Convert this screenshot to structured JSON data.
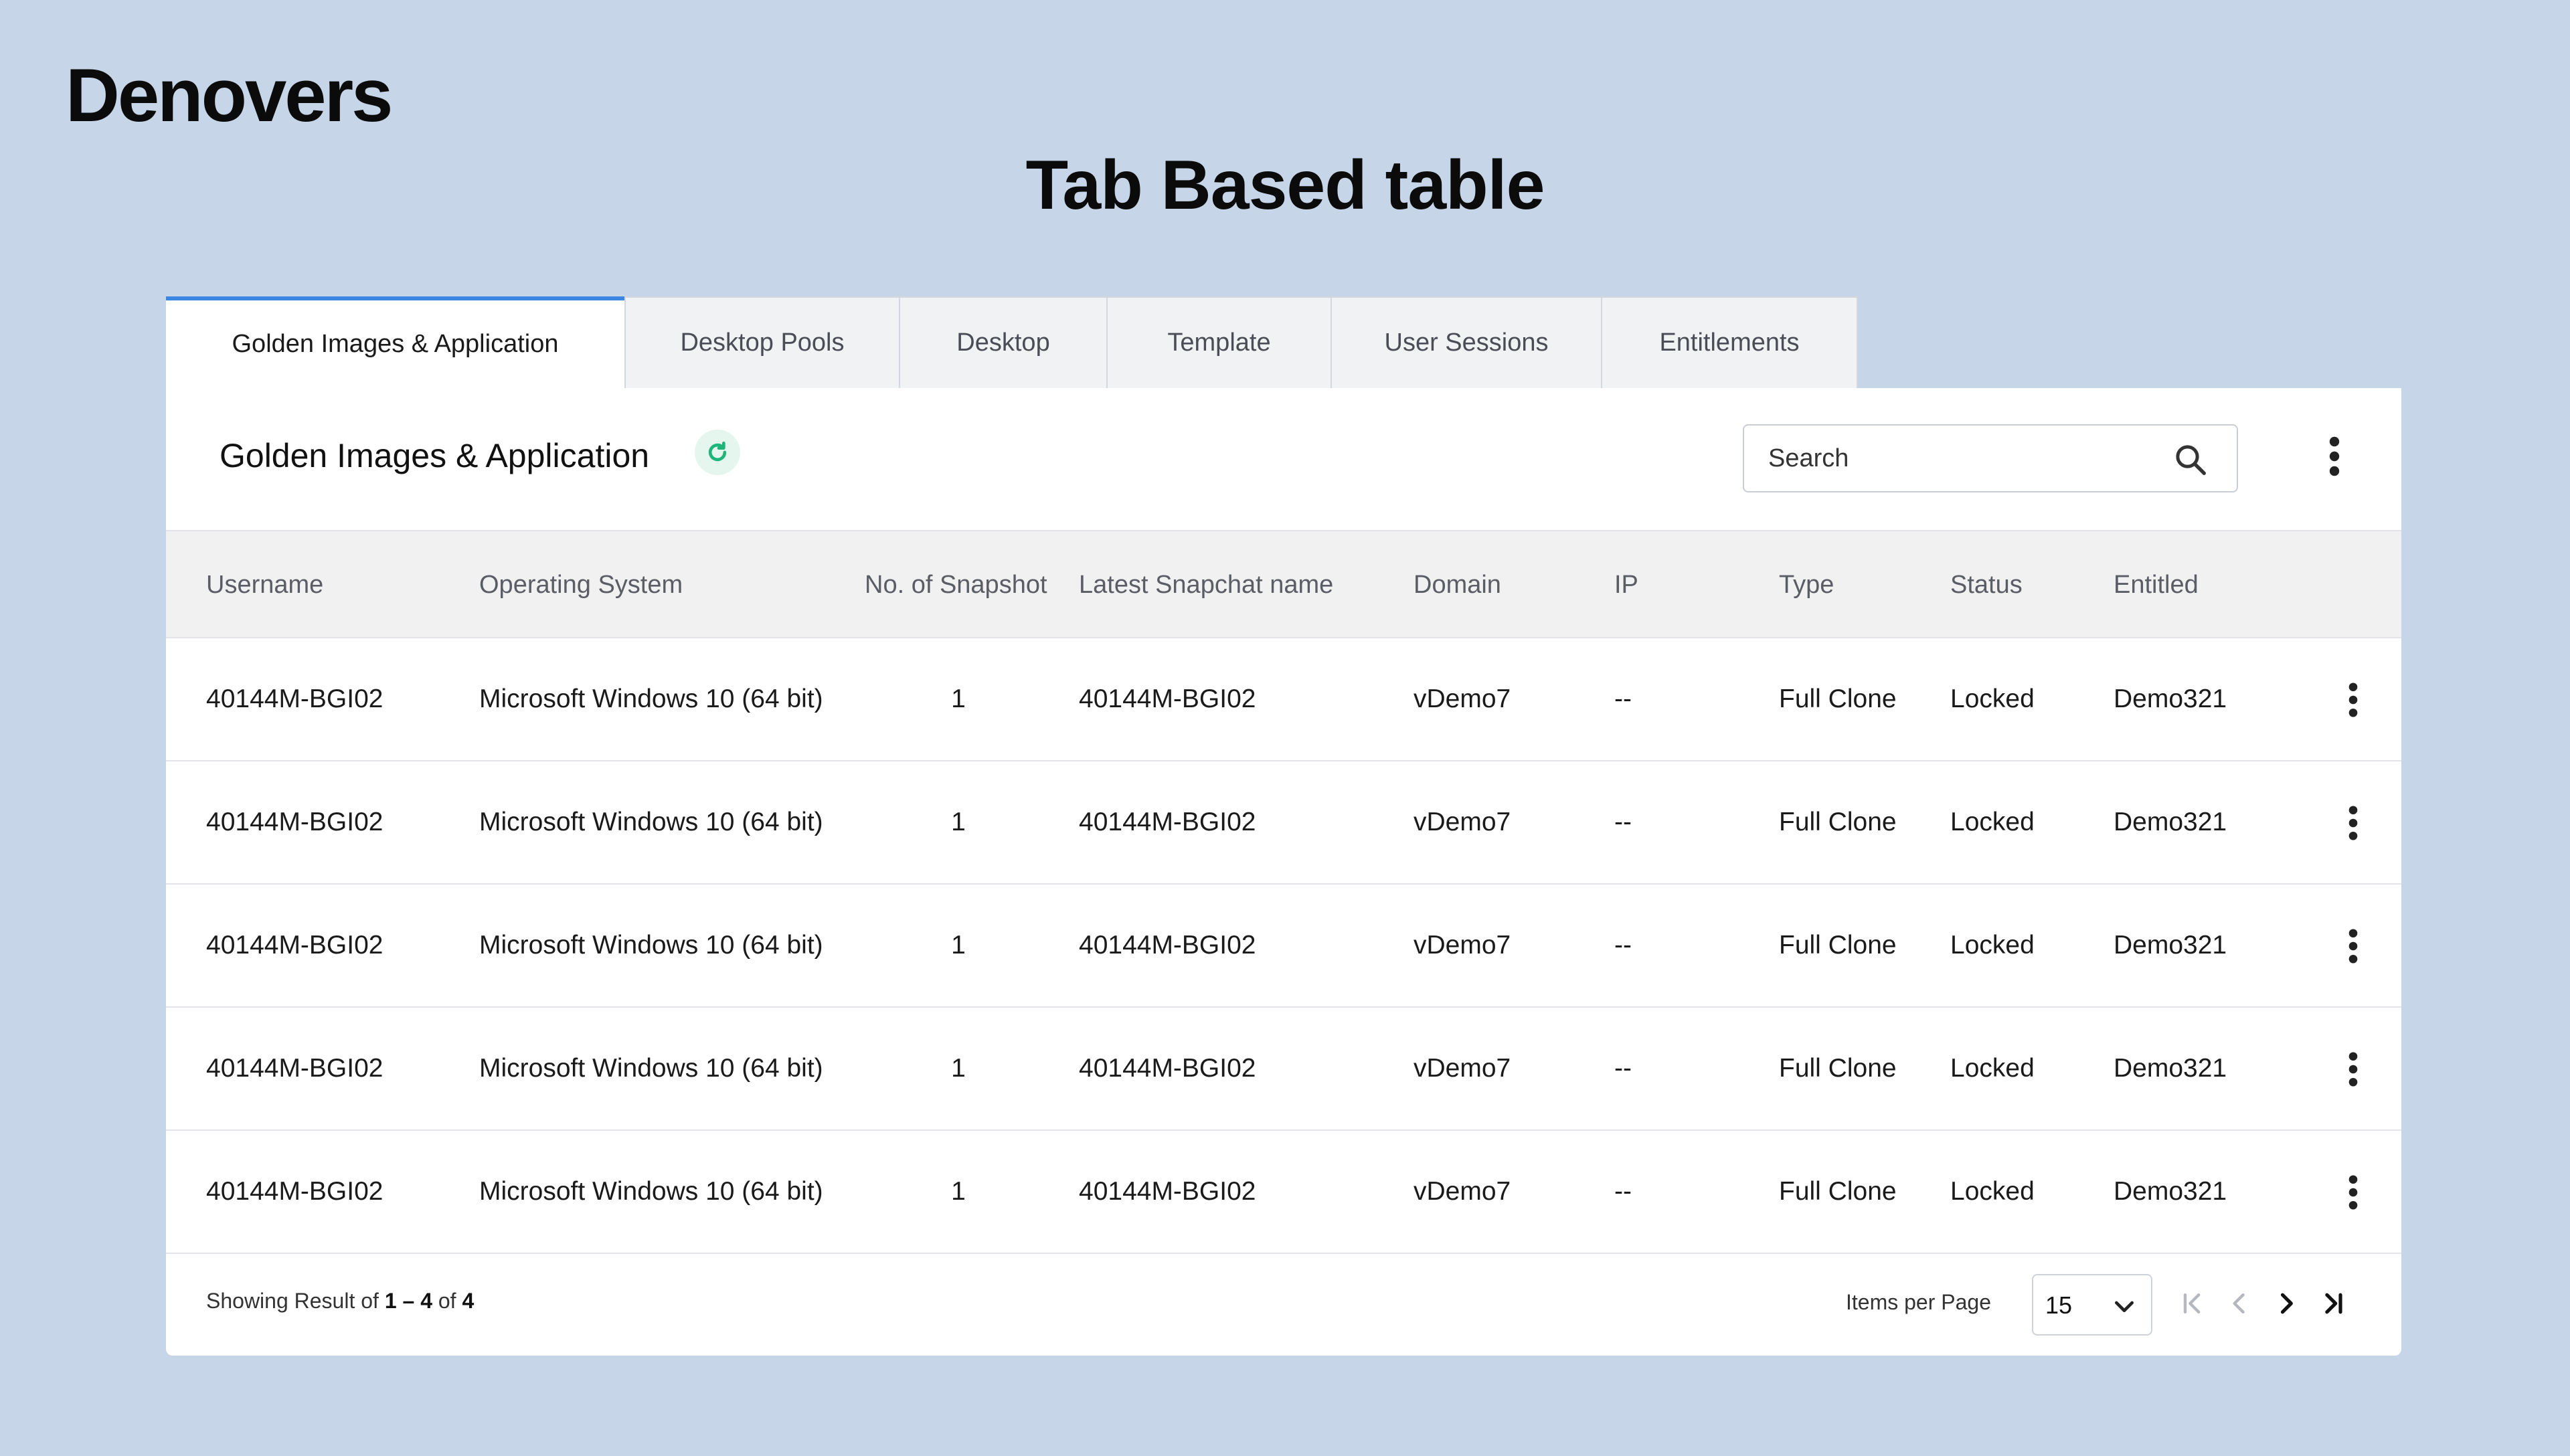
{
  "brand": "Denovers",
  "page_title": "Tab Based table",
  "tabs": [
    {
      "label": "Golden Images & Application",
      "active": true
    },
    {
      "label": "Desktop Pools",
      "active": false
    },
    {
      "label": "Desktop",
      "active": false
    },
    {
      "label": "Template",
      "active": false
    },
    {
      "label": "User Sessions",
      "active": false
    },
    {
      "label": "Entitlements",
      "active": false
    }
  ],
  "card": {
    "title": "Golden Images & Application",
    "refresh_icon": "refresh-icon",
    "search": {
      "placeholder": "Search",
      "value": ""
    },
    "more_icon": "kebab-icon"
  },
  "table": {
    "columns": [
      "Username",
      "Operating System",
      "No. of Snapshot",
      "Latest Snapchat name",
      "Domain",
      "IP",
      "Type",
      "Status",
      "Entitled"
    ],
    "rows": [
      [
        "40144M-BGI02",
        "Microsoft Windows 10 (64 bit)",
        "1",
        "40144M-BGI02",
        "vDemo7",
        "--",
        "Full Clone",
        "Locked",
        "Demo321"
      ],
      [
        "40144M-BGI02",
        "Microsoft Windows 10 (64 bit)",
        "1",
        "40144M-BGI02",
        "vDemo7",
        "--",
        "Full Clone",
        "Locked",
        "Demo321"
      ],
      [
        "40144M-BGI02",
        "Microsoft Windows 10 (64 bit)",
        "1",
        "40144M-BGI02",
        "vDemo7",
        "--",
        "Full Clone",
        "Locked",
        "Demo321"
      ],
      [
        "40144M-BGI02",
        "Microsoft Windows 10 (64 bit)",
        "1",
        "40144M-BGI02",
        "vDemo7",
        "--",
        "Full Clone",
        "Locked",
        "Demo321"
      ],
      [
        "40144M-BGI02",
        "Microsoft Windows 10 (64 bit)",
        "1",
        "40144M-BGI02",
        "vDemo7",
        "--",
        "Full Clone",
        "Locked",
        "Demo321"
      ]
    ]
  },
  "footer": {
    "result_prefix": "Showing Result of ",
    "result_range": "1 – 4",
    "result_of": " of ",
    "result_total": "4",
    "items_per_page_label": "Items per Page",
    "items_per_page_value": "15"
  },
  "colors": {
    "background": "#c6d6e8",
    "active_tab_accent": "#3b86e3",
    "refresh_accent": "#1fb57a",
    "header_bg": "#f1f1f2"
  }
}
